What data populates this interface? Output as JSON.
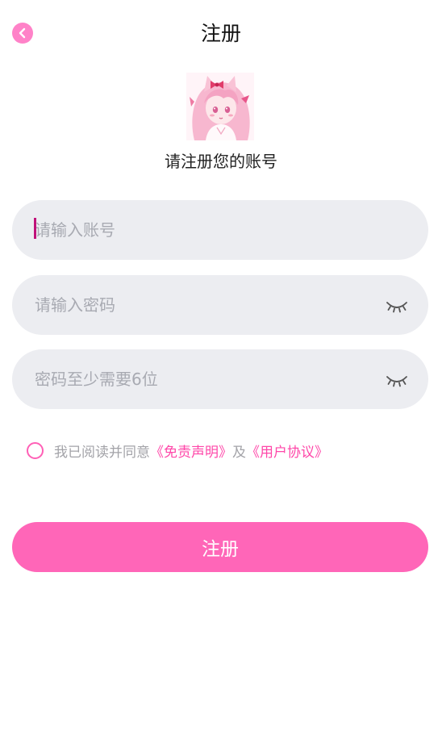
{
  "header": {
    "title": "注册",
    "back_icon": "chevron-left-icon"
  },
  "avatar": {
    "description": "anime-girl-avatar"
  },
  "subtitle": "请注册您的账号",
  "form": {
    "account": {
      "placeholder": "请输入账号",
      "value": ""
    },
    "password": {
      "placeholder": "请输入密码",
      "value": "",
      "toggle_icon": "eye-closed-icon"
    },
    "confirm": {
      "placeholder": "密码至少需要6位",
      "value": "",
      "toggle_icon": "eye-closed-icon"
    }
  },
  "agreement": {
    "prefix": "我已阅读并同意",
    "disclaimer": "《免责声明》",
    "and": "及",
    "user_agreement": "《用户协议》",
    "checked": false
  },
  "submit_label": "注册",
  "colors": {
    "accent": "#ff66b8",
    "link": "#ff47a9",
    "field_bg": "#ecedf1",
    "back_button": "#ff82c8"
  }
}
